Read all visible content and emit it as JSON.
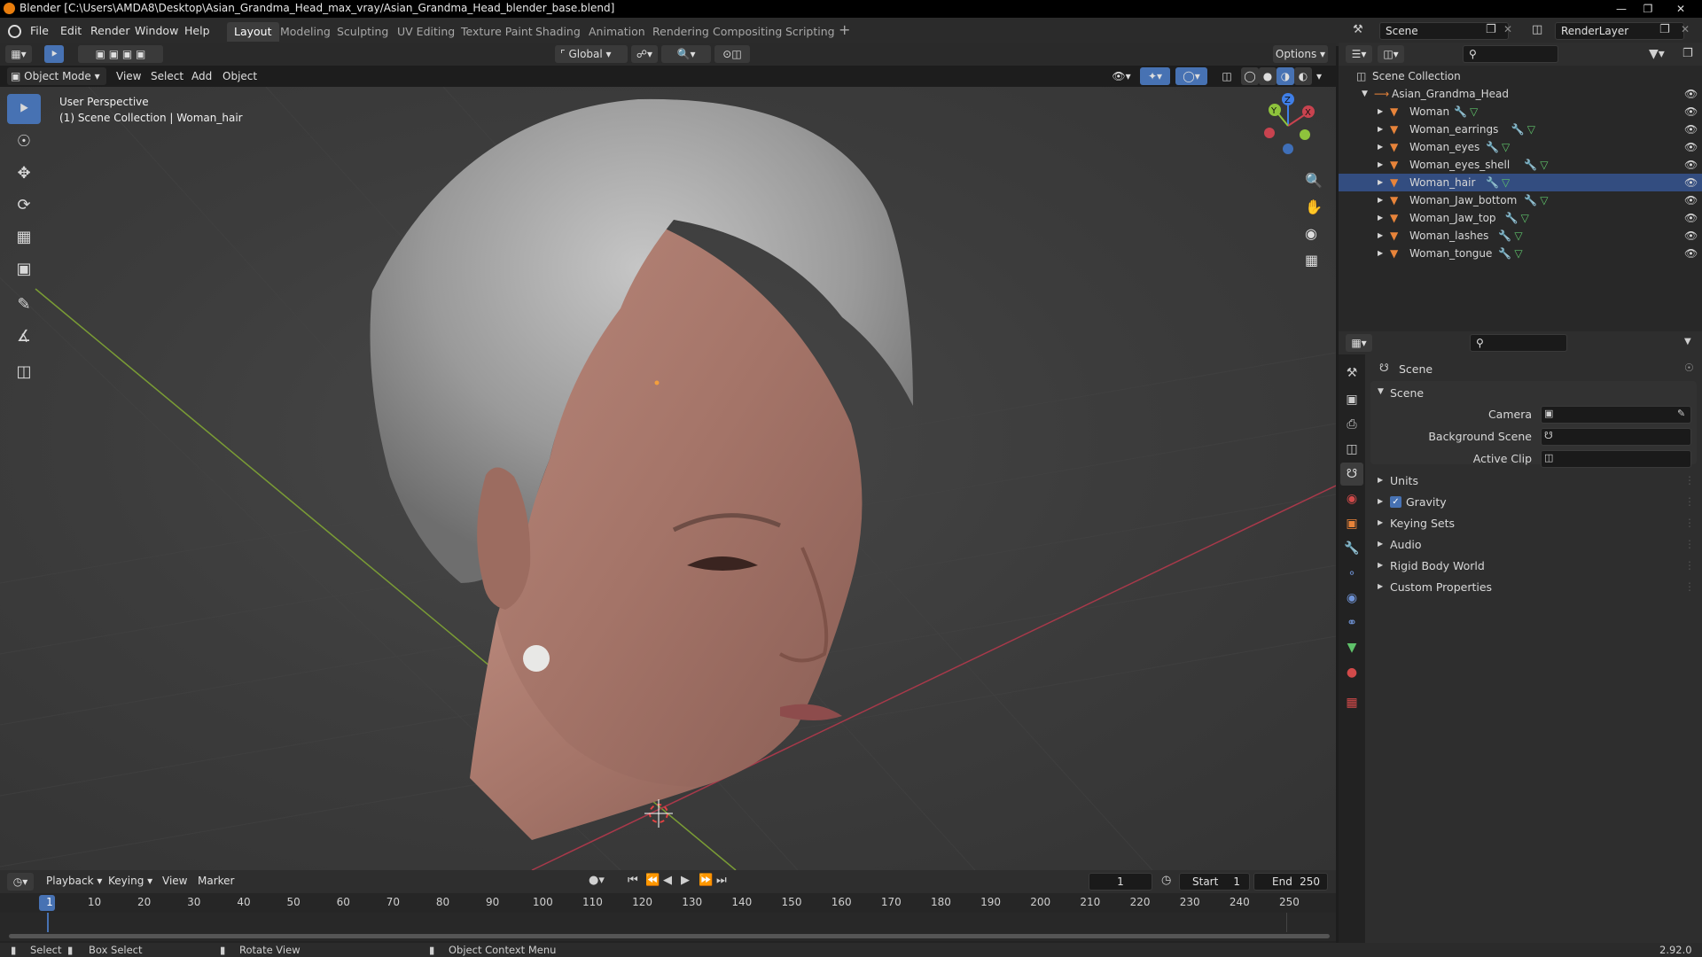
{
  "window": {
    "title": "Blender [C:\\Users\\AMDA8\\Desktop\\Asian_Grandma_Head_max_vray/Asian_Grandma_Head_blender_base.blend]"
  },
  "menu": {
    "items": [
      "File",
      "Edit",
      "Render",
      "Window",
      "Help"
    ]
  },
  "workspaces": [
    "Layout",
    "Modeling",
    "Sculpting",
    "UV Editing",
    "Texture Paint",
    "Shading",
    "Animation",
    "Rendering",
    "Compositing",
    "Scripting"
  ],
  "active_workspace": "Layout",
  "scene_selector": {
    "value": "Scene"
  },
  "renderlayer_selector": {
    "value": "RenderLayer"
  },
  "viewport_header": {
    "mode": "Object Mode",
    "menus": [
      "View",
      "Select",
      "Add",
      "Object"
    ],
    "transform_orientation": "Global",
    "options_label": "Options"
  },
  "viewport": {
    "perspective_label": "User Perspective",
    "collection_label": "(1) Scene Collection | Woman_hair"
  },
  "outliner": {
    "root": "Scene Collection",
    "collection": "Asian_Grandma_Head",
    "objects": [
      "Woman",
      "Woman_earrings",
      "Woman_eyes",
      "Woman_eyes_shell",
      "Woman_hair",
      "Woman_Jaw_bottom",
      "Woman_Jaw_top",
      "Woman_lashes",
      "Woman_tongue"
    ],
    "active_object": "Woman_hair"
  },
  "properties": {
    "context_title": "Scene",
    "panel_title": "Scene",
    "fields": [
      {
        "label": "Camera",
        "value": ""
      },
      {
        "label": "Background Scene",
        "value": ""
      },
      {
        "label": "Active Clip",
        "value": ""
      }
    ],
    "sections": [
      {
        "label": "Units",
        "checkbox": false
      },
      {
        "label": "Gravity",
        "checkbox": true
      },
      {
        "label": "Keying Sets",
        "checkbox": false
      },
      {
        "label": "Audio",
        "checkbox": false
      },
      {
        "label": "Rigid Body World",
        "checkbox": false
      },
      {
        "label": "Custom Properties",
        "checkbox": false
      }
    ]
  },
  "timeline": {
    "menus": [
      "Playback",
      "Keying",
      "View",
      "Marker"
    ],
    "current_frame": "1",
    "start_label": "Start",
    "start_value": "1",
    "end_label": "End",
    "end_value": "250",
    "ruler": [
      "1",
      "10",
      "20",
      "30",
      "40",
      "50",
      "60",
      "70",
      "80",
      "90",
      "100",
      "110",
      "120",
      "130",
      "140",
      "150",
      "160",
      "170",
      "180",
      "190",
      "200",
      "210",
      "220",
      "230",
      "240",
      "250"
    ]
  },
  "statusbar": {
    "select": "Select",
    "box_select": "Box Select",
    "rotate_view": "Rotate View",
    "context_menu": "Object Context Menu",
    "version": "2.92.0"
  },
  "colors": {
    "accent": "#4772b3",
    "object_orange": "#e8843a",
    "axis_x": "#c8434f",
    "axis_y": "#8ec33c",
    "axis_z": "#3f7fe8"
  }
}
